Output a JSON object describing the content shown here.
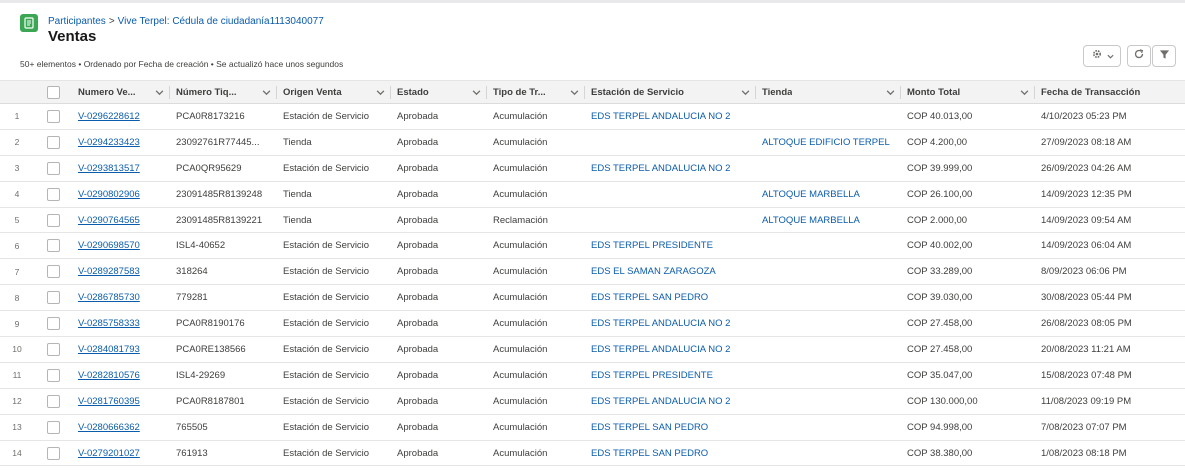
{
  "header": {
    "breadcrumb_parent": "Participantes",
    "breadcrumb_separator": ">",
    "breadcrumb_current": "Vive Terpel: Cédula de ciudadanía1113040077",
    "title": "Ventas",
    "status_line": "50+ elementos • Ordenado por Fecha de creación • Se actualizó hace unos segundos",
    "icons": [
      "sales-object-icon",
      "gear-icon",
      "chevron-down-icon",
      "refresh-icon",
      "filter-icon"
    ]
  },
  "colors": {
    "link": "#0b5cab",
    "object_icon": "#3ba755",
    "header_bg": "#f3f3f3"
  },
  "table": {
    "columns": [
      "Numero Ve...",
      "Número Tiq...",
      "Origen Venta",
      "Estado",
      "Tipo de Tr...",
      "Estación de Servicio",
      "Tienda",
      "Monto Total",
      "Fecha de Transacción"
    ],
    "rows": [
      {
        "n": "1",
        "numero": "V-0296228612",
        "tiquete": "PCA0R8173216",
        "origen": "Estación de Servicio",
        "estado": "Aprobada",
        "tipo": "Acumulación",
        "estacion": "EDS TERPEL ANDALUCIA NO 2",
        "tienda": "",
        "monto": "COP 40.013,00",
        "fecha": "4/10/2023 05:23 PM"
      },
      {
        "n": "2",
        "numero": "V-0294233423",
        "tiquete": "23092761R77445...",
        "origen": "Tienda",
        "estado": "Aprobada",
        "tipo": "Acumulación",
        "estacion": "",
        "tienda": "ALTOQUE EDIFICIO TERPEL",
        "monto": "COP 4.200,00",
        "fecha": "27/09/2023 08:18 AM"
      },
      {
        "n": "3",
        "numero": "V-0293813517",
        "tiquete": "PCA0QR95629",
        "origen": "Estación de Servicio",
        "estado": "Aprobada",
        "tipo": "Acumulación",
        "estacion": "EDS TERPEL ANDALUCIA NO 2",
        "tienda": "",
        "monto": "COP 39.999,00",
        "fecha": "26/09/2023 04:26 AM"
      },
      {
        "n": "4",
        "numero": "V-0290802906",
        "tiquete": "23091485R8139248",
        "origen": "Tienda",
        "estado": "Aprobada",
        "tipo": "Acumulación",
        "estacion": "",
        "tienda": "ALTOQUE MARBELLA",
        "monto": "COP 26.100,00",
        "fecha": "14/09/2023 12:35 PM"
      },
      {
        "n": "5",
        "numero": "V-0290764565",
        "tiquete": "23091485R8139221",
        "origen": "Tienda",
        "estado": "Aprobada",
        "tipo": "Reclamación",
        "estacion": "",
        "tienda": "ALTOQUE MARBELLA",
        "monto": "COP 2.000,00",
        "fecha": "14/09/2023 09:54 AM"
      },
      {
        "n": "6",
        "numero": "V-0290698570",
        "tiquete": "ISL4-40652",
        "origen": "Estación de Servicio",
        "estado": "Aprobada",
        "tipo": "Acumulación",
        "estacion": "EDS TERPEL PRESIDENTE",
        "tienda": "",
        "monto": "COP 40.002,00",
        "fecha": "14/09/2023 06:04 AM"
      },
      {
        "n": "7",
        "numero": "V-0289287583",
        "tiquete": "318264",
        "origen": "Estación de Servicio",
        "estado": "Aprobada",
        "tipo": "Acumulación",
        "estacion": "EDS EL SAMAN ZARAGOZA",
        "tienda": "",
        "monto": "COP 33.289,00",
        "fecha": "8/09/2023 06:06 PM"
      },
      {
        "n": "8",
        "numero": "V-0286785730",
        "tiquete": "779281",
        "origen": "Estación de Servicio",
        "estado": "Aprobada",
        "tipo": "Acumulación",
        "estacion": "EDS TERPEL SAN PEDRO",
        "tienda": "",
        "monto": "COP 39.030,00",
        "fecha": "30/08/2023 05:44 PM"
      },
      {
        "n": "9",
        "numero": "V-0285758333",
        "tiquete": "PCA0R8190176",
        "origen": "Estación de Servicio",
        "estado": "Aprobada",
        "tipo": "Acumulación",
        "estacion": "EDS TERPEL ANDALUCIA NO 2",
        "tienda": "",
        "monto": "COP 27.458,00",
        "fecha": "26/08/2023 08:05 PM"
      },
      {
        "n": "10",
        "numero": "V-0284081793",
        "tiquete": "PCA0RE138566",
        "origen": "Estación de Servicio",
        "estado": "Aprobada",
        "tipo": "Acumulación",
        "estacion": "EDS TERPEL ANDALUCIA NO 2",
        "tienda": "",
        "monto": "COP 27.458,00",
        "fecha": "20/08/2023 11:21 AM"
      },
      {
        "n": "11",
        "numero": "V-0282810576",
        "tiquete": "ISL4-29269",
        "origen": "Estación de Servicio",
        "estado": "Aprobada",
        "tipo": "Acumulación",
        "estacion": "EDS TERPEL PRESIDENTE",
        "tienda": "",
        "monto": "COP 35.047,00",
        "fecha": "15/08/2023 07:48 PM"
      },
      {
        "n": "12",
        "numero": "V-0281760395",
        "tiquete": "PCA0R8187801",
        "origen": "Estación de Servicio",
        "estado": "Aprobada",
        "tipo": "Acumulación",
        "estacion": "EDS TERPEL ANDALUCIA NO 2",
        "tienda": "",
        "monto": "COP 130.000,00",
        "fecha": "11/08/2023 09:19 PM"
      },
      {
        "n": "13",
        "numero": "V-0280666362",
        "tiquete": "765505",
        "origen": "Estación de Servicio",
        "estado": "Aprobada",
        "tipo": "Acumulación",
        "estacion": "EDS TERPEL SAN PEDRO",
        "tienda": "",
        "monto": "COP 94.998,00",
        "fecha": "7/08/2023 07:07 PM"
      },
      {
        "n": "14",
        "numero": "V-0279201027",
        "tiquete": "761913",
        "origen": "Estación de Servicio",
        "estado": "Aprobada",
        "tipo": "Acumulación",
        "estacion": "EDS TERPEL SAN PEDRO",
        "tienda": "",
        "monto": "COP 38.380,00",
        "fecha": "1/08/2023 08:18 PM"
      }
    ]
  }
}
